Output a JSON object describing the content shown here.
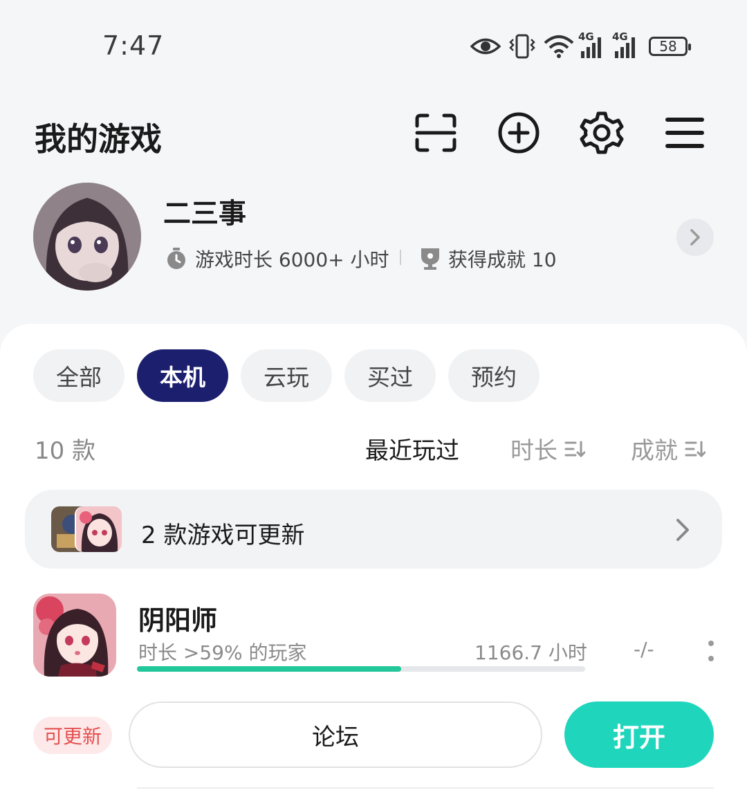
{
  "status_bar": {
    "time": "7:47",
    "battery": "58",
    "network_1": "4G",
    "network_2": "4G"
  },
  "header": {
    "title": "我的游戏",
    "icons": [
      "scan-icon",
      "add-circle-icon",
      "settings-icon",
      "menu-icon"
    ]
  },
  "profile": {
    "name": "二三事",
    "playtime": "游戏时长 6000+ 小时",
    "achievements": "获得成就 10"
  },
  "tabs": [
    {
      "label": "全部",
      "active": false
    },
    {
      "label": "本机",
      "active": true
    },
    {
      "label": "云玩",
      "active": false
    },
    {
      "label": "买过",
      "active": false
    },
    {
      "label": "预约",
      "active": false
    }
  ],
  "list": {
    "count": "10 款",
    "sort_options": [
      "最近玩过",
      "时长",
      "成就"
    ],
    "sort_active": "最近玩过"
  },
  "update_banner": {
    "text": "2 款游戏可更新"
  },
  "games": [
    {
      "name": "阴阳师",
      "subtitle": "时长 >59% 的玩家",
      "hours": "1166.7 小时",
      "achievements": "-/-",
      "progress": 0.59,
      "badge": "可更新",
      "forum_label": "论坛",
      "open_label": "打开"
    }
  ],
  "colors": {
    "accent": "#1c1f6e",
    "open_button": "#1fd6bc",
    "progress": "#22c79a",
    "badge_text": "#e55050"
  }
}
